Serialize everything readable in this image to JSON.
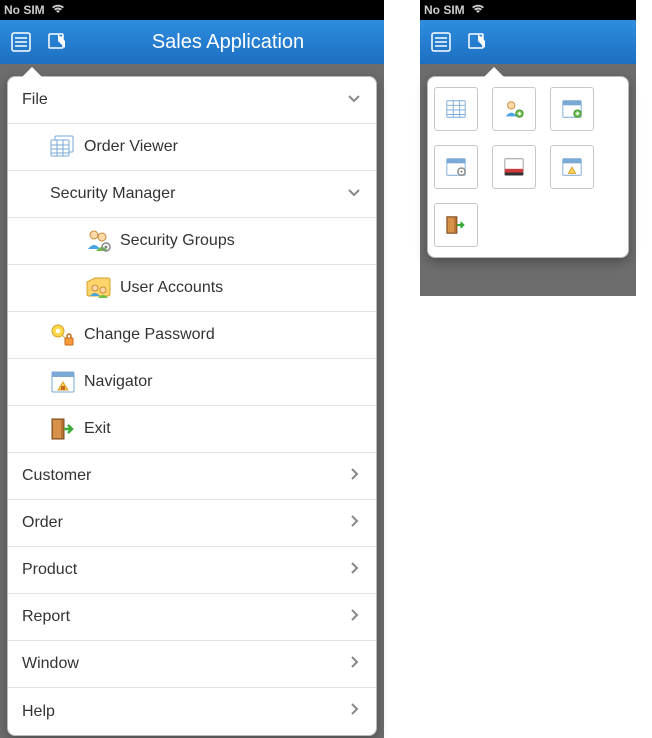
{
  "statusbar": {
    "no_sim": "No SIM"
  },
  "topbar": {
    "title": "Sales Application"
  },
  "menu": {
    "file": "File",
    "order_viewer": "Order Viewer",
    "security_manager": "Security Manager",
    "security_groups": "Security Groups",
    "user_accounts": "User Accounts",
    "change_password": "Change Password",
    "navigator": "Navigator",
    "exit": "Exit",
    "customer": "Customer",
    "order": "Order",
    "product": "Product",
    "report": "Report",
    "window": "Window",
    "help": "Help"
  }
}
